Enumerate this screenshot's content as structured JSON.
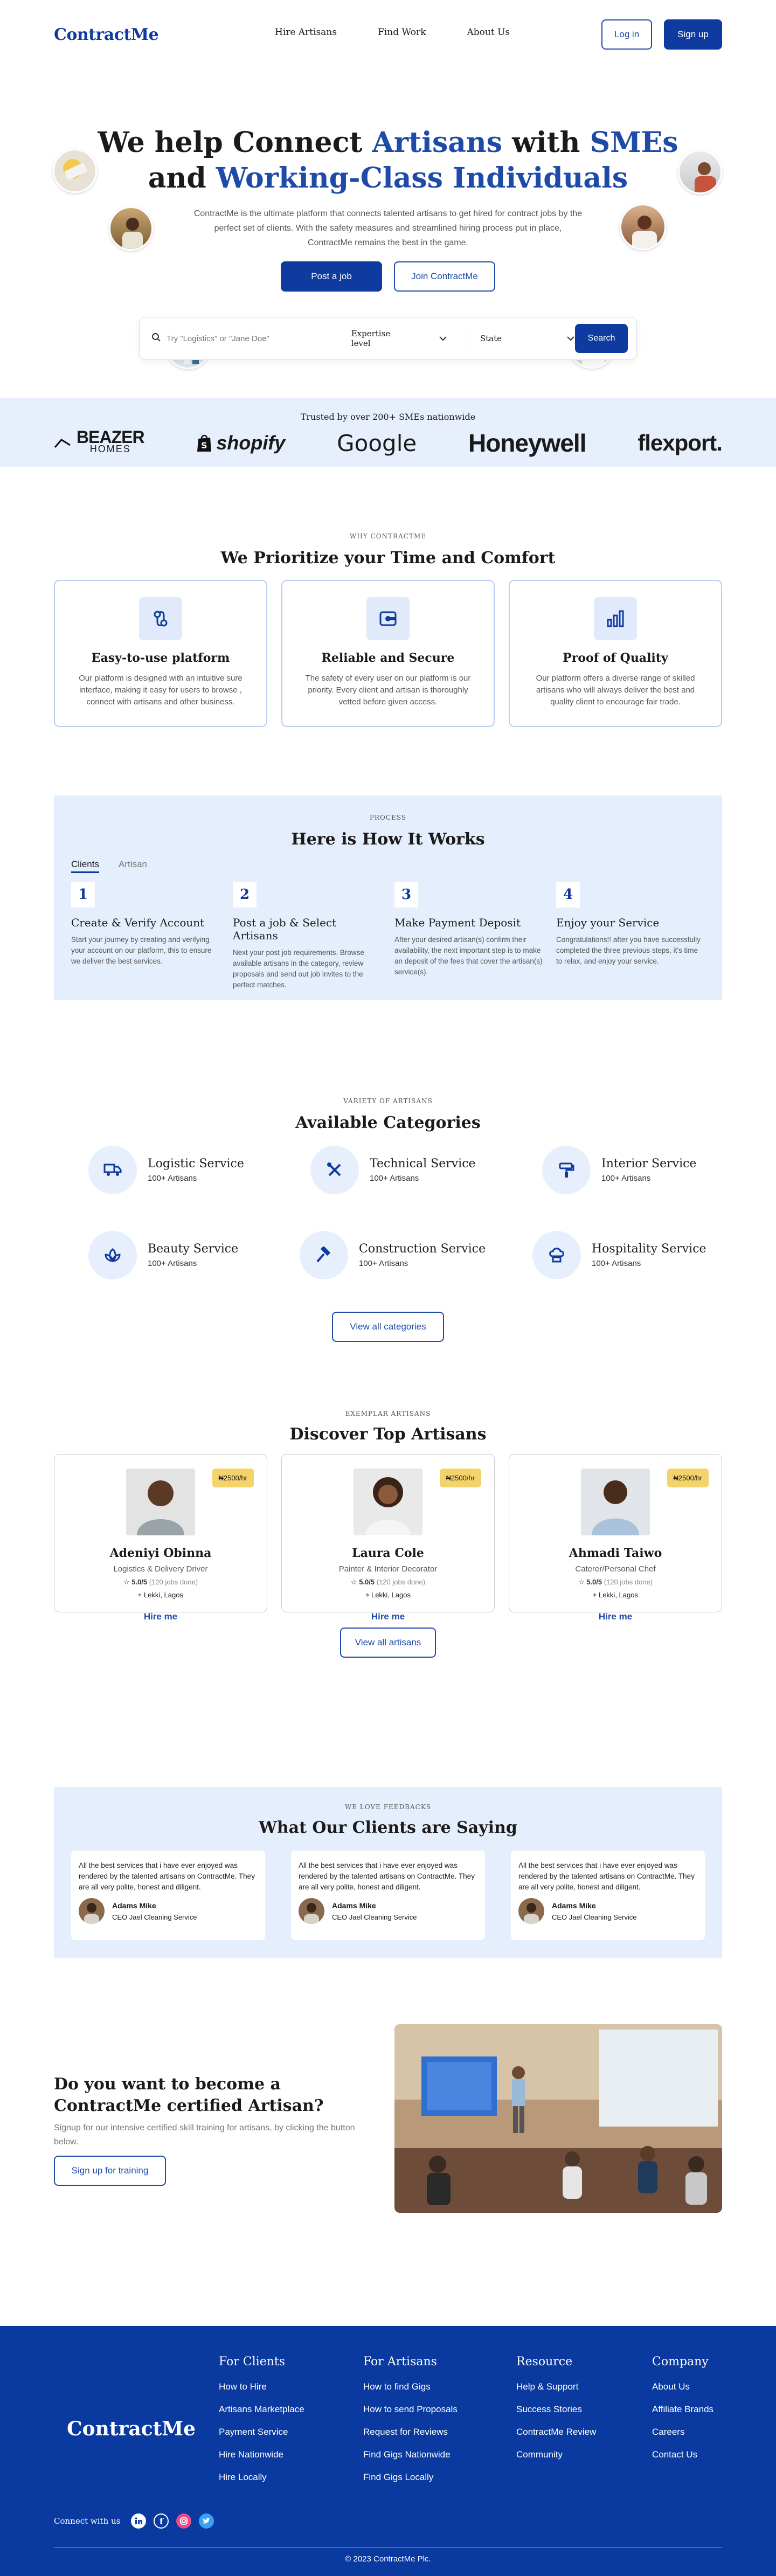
{
  "nav": {
    "logo": "ContractMe",
    "links": [
      "Hire Artisans",
      "Find Work",
      "About Us"
    ],
    "login": "Log in",
    "signup": "Sign up"
  },
  "hero": {
    "title_parts": [
      "We help Connect ",
      "Artisans",
      " with ",
      "SMEs",
      "and ",
      "Working-Class Individuals"
    ],
    "subtitle": "ContractMe is the ultimate platform that connects talented artisans to get hired for contract jobs by the perfect set of clients. With the safety measures and streamlined hiring process put in place, ContractMe remains the best in the game.",
    "post_job": "Post a job",
    "join": "Join ContractMe",
    "search_placeholder": "Try \"Logistics\" or \"Jane Doe\"",
    "expertise": "Expertise level",
    "state": "State",
    "search_btn": "Search"
  },
  "trust": {
    "title": "Trusted by over 200+ SMEs nationwide",
    "brands": [
      "BEAZER",
      "HOMES",
      "shopify",
      "Google",
      "Honeywell",
      "flexport."
    ]
  },
  "priorities": {
    "kicker": "WHY CONTRACTME",
    "title": "We Prioritize your Time and Comfort",
    "cards": [
      {
        "title": "Easy-to-use platform",
        "text": "Our platform is designed with an intuitive sure interface, making it easy for users to browse , connect with artisans and other business.",
        "icon": "route-icon"
      },
      {
        "title": "Reliable and Secure",
        "text": "The safety of every user on our platform is our priority. Every client and artisan is thoroughly vetted before given access.",
        "icon": "shield-card-icon"
      },
      {
        "title": "Proof of Quality",
        "text": "Our platform offers a diverse range of skilled artisans who will always deliver the best and quality client to encourage fair trade.",
        "icon": "bar-chart-icon"
      }
    ]
  },
  "how": {
    "kicker": "PROCESS",
    "title": "Here is How It Works",
    "tabs": [
      "Clients",
      "Artisan"
    ],
    "steps": [
      {
        "num": "1",
        "title": "Create & Verify Account",
        "text": "Start your journey by creating and verifying your account on our platform, this to ensure we deliver the best services."
      },
      {
        "num": "2",
        "title": "Post a job & Select Artisans",
        "text": "Next your post job requirements. Browse available artisans in the category, review proposals and send out job invites to the perfect matches."
      },
      {
        "num": "3",
        "title": "Make Payment Deposit",
        "text": "After your desired artisan(s) confirm their availability, the next important step is to make an deposit of the fees that cover the artisan(s) service(s)."
      },
      {
        "num": "4",
        "title": "Enjoy your Service",
        "text": " Congratulations!! after you have successfully completed the three previous steps, it's time to relax, and enjoy your service."
      }
    ]
  },
  "categories": {
    "kicker": "VARIETY OF ARTISANS",
    "title": "Available Categories",
    "items": [
      {
        "name": "Logistic Service",
        "count": "100+ Artisans"
      },
      {
        "name": "Technical Service",
        "count": "100+ Artisans"
      },
      {
        "name": "Interior Service",
        "count": "100+ Artisans"
      },
      {
        "name": "Beauty Service",
        "count": "100+ Artisans"
      },
      {
        "name": "Construction Service",
        "count": "100+ Artisans"
      },
      {
        "name": "Hospitality Service",
        "count": "100+ Artisans"
      }
    ],
    "view_all": "View all categories"
  },
  "artisans": {
    "kicker": "EXEMPLAR ARTISANS",
    "title": "Discover Top Artisans",
    "items": [
      {
        "name": "Adeniyi Obinna",
        "role": "Logistics & Delivery Driver",
        "price": "₦2500/hr",
        "rating": "5.0/5",
        "jobs": "(120 jobs done)",
        "location": "Lekki, Lagos",
        "hire": "Hire me"
      },
      {
        "name": "Laura Cole",
        "role": "Painter & Interior Decorator",
        "price": "₦2500/hr",
        "rating": "5.0/5",
        "jobs": "(120 jobs done)",
        "location": "Lekki, Lagos",
        "hire": "Hire me"
      },
      {
        "name": "Ahmadi Taiwo",
        "role": "Caterer/Personal Chef",
        "price": "₦2500/hr",
        "rating": "5.0/5",
        "jobs": "(120 jobs done)",
        "location": "Lekki, Lagos",
        "hire": "Hire me"
      }
    ],
    "view_all": "View all artisans"
  },
  "testimonials": {
    "kicker": "WE LOVE FEEDBACKS",
    "title": "What Our Clients are Saying",
    "items": [
      {
        "text": "All the best services that i have ever enjoyed was rendered by the talented artisans on ContractMe. They are all very polite, honest and diligent.",
        "name": "Adams Mike",
        "role": "CEO Jael Cleaning Service"
      },
      {
        "text": "All the best services that i have ever enjoyed was rendered by the talented artisans on ContractMe. They are all very polite, honest and diligent.",
        "name": "Adams Mike",
        "role": "CEO Jael Cleaning Service"
      },
      {
        "text": "All the best services that i have ever enjoyed was rendered by the talented artisans on ContractMe. They are all very polite, honest and diligent.",
        "name": "Adams Mike",
        "role": "CEO Jael Cleaning Service"
      }
    ]
  },
  "cta": {
    "title": "Do you want to become a ContractMe certified Artisan?",
    "text": "Signup for our intensive certified skill training for artisans, by clicking the button below.",
    "button": "Sign up for training"
  },
  "footer": {
    "logo": "ContractMe",
    "cols": [
      {
        "title": "For Clients",
        "items": [
          "How to Hire",
          "Artisans Marketplace",
          "Payment Service",
          "Hire Nationwide",
          "Hire Locally"
        ]
      },
      {
        "title": "For Artisans",
        "items": [
          "How to find Gigs",
          "How to send Proposals",
          "Request for Reviews",
          "Find Gigs Nationwide",
          "Find Gigs Locally"
        ]
      },
      {
        "title": "Resource",
        "items": [
          "Help & Support",
          "Success Stories",
          "ContractMe Review",
          "Community"
        ]
      },
      {
        "title": "Company",
        "items": [
          "About Us",
          "Affiliate Brands",
          "Careers",
          "Contact Us"
        ]
      }
    ],
    "connect": "Connect with us",
    "copyright": "© 2023 ContractMe  Plc."
  },
  "colors": {
    "primary": "#0f3aa0",
    "accent": "#1e4aa8",
    "light": "#e5eefc",
    "badge": "#f5d36b"
  }
}
